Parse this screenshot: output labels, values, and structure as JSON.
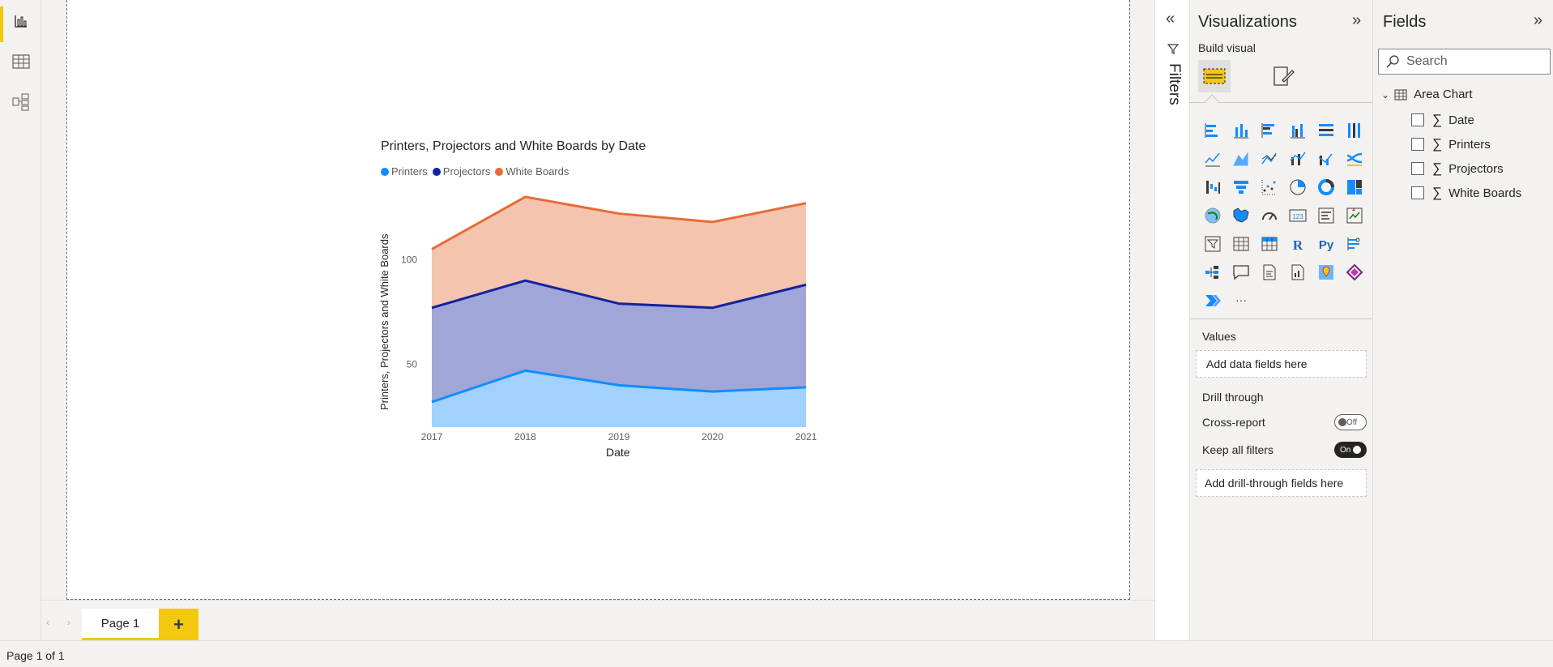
{
  "status": {
    "page_indicator": "Page 1 of 1"
  },
  "tabs": {
    "page1": "Page 1",
    "add": "+"
  },
  "filters": {
    "label": "Filters"
  },
  "visualizations": {
    "title": "Visualizations",
    "build_visual": "Build visual",
    "values_label": "Values",
    "values_placeholder": "Add data fields here",
    "drill_through": "Drill through",
    "cross_report": "Cross-report",
    "cross_report_state": "Off",
    "keep_all_filters": "Keep all filters",
    "keep_all_filters_state": "On",
    "drill_placeholder": "Add drill-through fields here",
    "more": "···",
    "r_label": "R",
    "py_label": "Py"
  },
  "fields": {
    "title": "Fields",
    "search_placeholder": "Search",
    "table_name": "Area Chart",
    "items": [
      "Date",
      "Printers",
      "Projectors",
      "White Boards"
    ]
  },
  "colors": {
    "accent": "#f2c811",
    "printers": "#118dff",
    "projectors": "#12239e",
    "white_boards": "#e66c37"
  },
  "chart_data": {
    "type": "area",
    "title": "Printers, Projectors and White Boards by Date",
    "xlabel": "Date",
    "ylabel": "Printers, Projectors and White Boards",
    "categories": [
      "2017",
      "2018",
      "2019",
      "2020",
      "2021"
    ],
    "series": [
      {
        "name": "Printers",
        "values": [
          32,
          47,
          40,
          37,
          39
        ]
      },
      {
        "name": "Projectors",
        "values": [
          45,
          43,
          39,
          40,
          49
        ]
      },
      {
        "name": "White Boards",
        "values": [
          28,
          40,
          43,
          41,
          39
        ]
      }
    ],
    "stacked": true,
    "y_ticks": [
      50,
      100
    ],
    "ylim": [
      20,
      135
    ],
    "legend_position": "top-left",
    "grid": true
  }
}
